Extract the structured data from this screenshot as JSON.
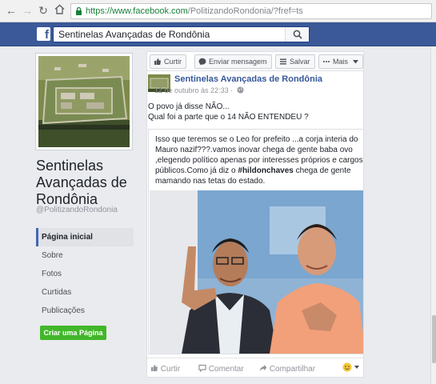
{
  "browser": {
    "url_host": "https://www.facebook.com",
    "url_path": "/PolitizandoRondonia/?fref=ts"
  },
  "fbbar": {
    "search_value": "Sentinelas Avançadas de Rondônia"
  },
  "page": {
    "name": "Sentinelas Avançadas de Rondônia",
    "handle": "@PolitizandoRondonia"
  },
  "left_nav": {
    "items": [
      "Página inicial",
      "Sobre",
      "Fotos",
      "Curtidas",
      "Publicações"
    ],
    "create_page": "Criar uma Página"
  },
  "action_bar": {
    "like": "Curtir",
    "message": "Enviar mensagem",
    "save": "Salvar",
    "more": "Mais"
  },
  "post": {
    "author": "Sentinelas Avançadas de Rondônia",
    "time": "12 de outubro às 22:33 ·",
    "text_line1": "O povo já disse NÃO...",
    "text_line2": "Qual foi a parte que o 14 NÃO ENTENDEU ?",
    "shared_text_before": "Isso que teremos se o Leo for prefeito ...a corja interia do Mauro nazif???.vamos inovar chega de gente baba ovo ,elegendo político apenas por interesses próprios e cargos públicos.Como já diz o ",
    "shared_hashtag": "#hildonchaves",
    "shared_text_after": " chega de gente mamando nas tetas do estado.",
    "actions": {
      "like": "Curtir",
      "comment": "Comentar",
      "share": "Compartilhar"
    }
  },
  "colors": {
    "fb_blue": "#3b5998",
    "link_blue": "#365899",
    "green": "#42b72a"
  }
}
